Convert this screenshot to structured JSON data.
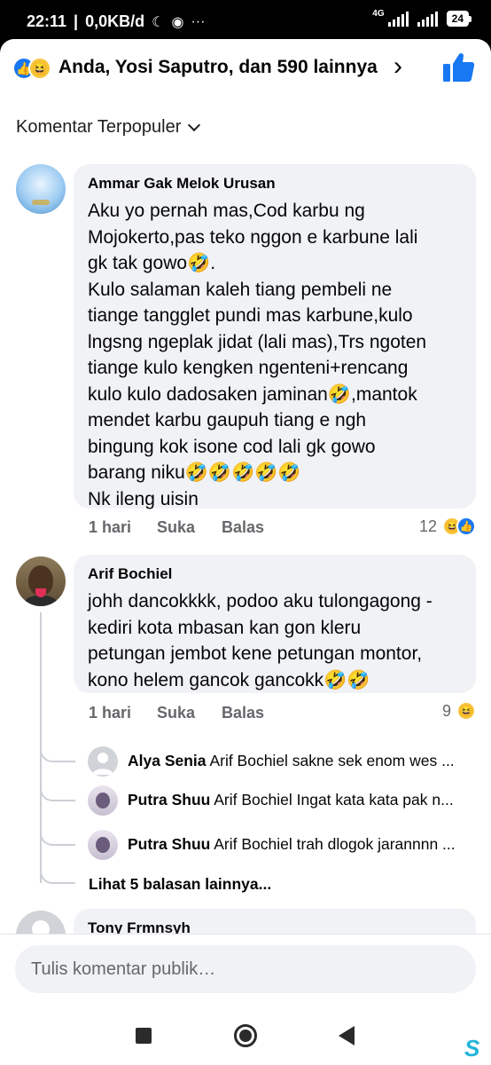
{
  "status_bar": {
    "time": "22:11",
    "speed": "0,0KB/d",
    "network": "4G",
    "battery": "24"
  },
  "reactions": {
    "summary": "Anda, Yosi Saputro, dan 590 lainnya"
  },
  "sort": {
    "label": "Komentar Terpopuler"
  },
  "comments": [
    {
      "author": "Ammar Gak Melok Urusan",
      "text": "Aku yo pernah mas,Cod karbu ng\nMojokerto,pas teko nggon e karbune lali\ngk tak gowo🤣.\nKulo salaman kaleh tiang pembeli ne\ntiange tangglet pundi mas karbune,kulo\nlngsng ngeplak jidat (lali mas),Trs ngoten\ntiange kulo kengken ngenteni+rencang\nkulo kulo dadosaken jaminan🤣,mantok\nmendet karbu gaupuh tiang e ngh\nbingung kok isone cod lali gk gowo\nbarang niku🤣🤣🤣🤣🤣\nNk ileng uisin",
      "time": "1 hari",
      "like": "Suka",
      "reply": "Balas",
      "reaction_count": "12"
    },
    {
      "author": "Arif Bochiel",
      "text": "johh dancokkkk, podoo aku tulongagong -\nkediri kota mbasan kan gon kleru\npetungan jembot kene petungan montor,\nkono helem gancok gancokk🤣🤣",
      "time": "1 hari",
      "like": "Suka",
      "reply": "Balas",
      "reaction_count": "9",
      "replies": [
        {
          "name": "Alya Senia",
          "text": "Arif Bochiel sakne sek enom wes ..."
        },
        {
          "name": "Putra Shuu",
          "text": "Arif Bochiel Ingat kata kata pak n..."
        },
        {
          "name": "Putra Shuu",
          "text": "Arif Bochiel trah dlogok jarannnn ..."
        }
      ],
      "more_replies": "Lihat 5 balasan lainnya..."
    },
    {
      "author": "Tony Frmnsyh"
    }
  ],
  "composer": {
    "placeholder": "Tulis komentar publik…"
  },
  "watermark": "S"
}
